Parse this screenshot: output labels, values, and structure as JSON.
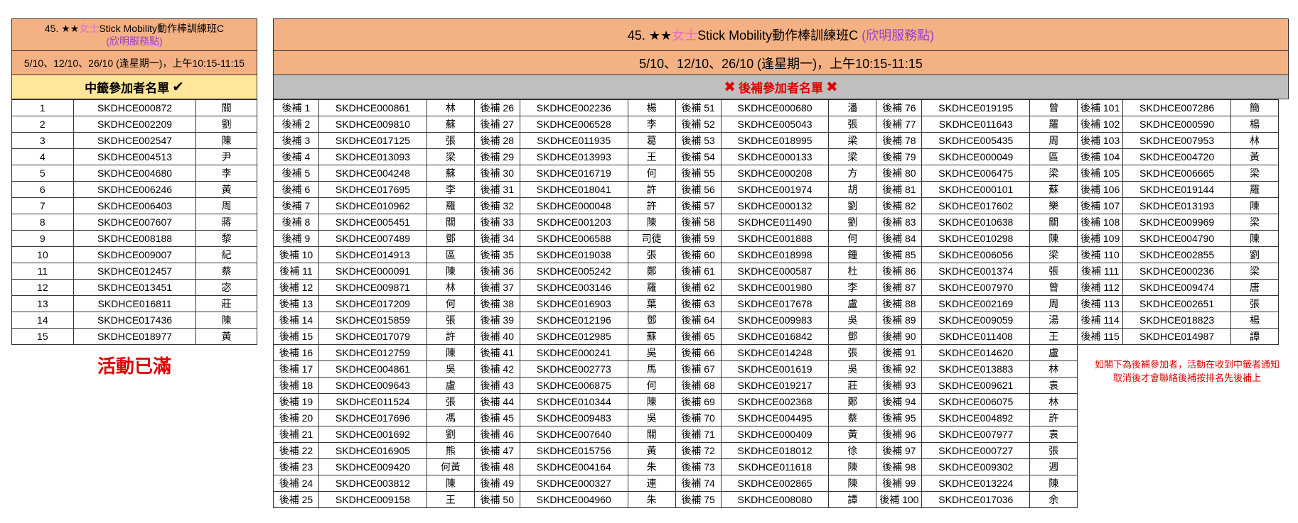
{
  "left": {
    "title_prefix": "45. ★★",
    "title_lady": "女士",
    "title_main": "Stick Mobility動作棒訓練班C",
    "center": "(欣明服務點)",
    "schedule": "5/10、12/10、26/10 (逢星期一)，上午10:15-11:15",
    "winners_title": "中籤參加者名單",
    "check": "✔",
    "rows": [
      [
        "1",
        "SKDHCE000872",
        "關"
      ],
      [
        "2",
        "SKDHCE002209",
        "劉"
      ],
      [
        "3",
        "SKDHCE002547",
        "陳"
      ],
      [
        "4",
        "SKDHCE004513",
        "尹"
      ],
      [
        "5",
        "SKDHCE004680",
        "李"
      ],
      [
        "6",
        "SKDHCE006246",
        "黃"
      ],
      [
        "7",
        "SKDHCE006403",
        "周"
      ],
      [
        "8",
        "SKDHCE007607",
        "蔣"
      ],
      [
        "9",
        "SKDHCE008188",
        "黎"
      ],
      [
        "10",
        "SKDHCE009007",
        "紀"
      ],
      [
        "11",
        "SKDHCE012457",
        "蔡"
      ],
      [
        "12",
        "SKDHCE013451",
        "宓"
      ],
      [
        "13",
        "SKDHCE016811",
        "莊"
      ],
      [
        "14",
        "SKDHCE017436",
        "陳"
      ],
      [
        "15",
        "SKDHCE018977",
        "黃"
      ]
    ],
    "full_label": "活動已滿"
  },
  "right": {
    "title_prefix": "45. ★★",
    "title_lady": "女士",
    "title_main": "Stick Mobility動作棒訓練班C ",
    "center": "(欣明服務點)",
    "schedule": "5/10、12/10、26/10 (逢星期一)，上午10:15-11:15",
    "waitlist_title": "後補參加者名單",
    "cross": "✖",
    "note_line1": "如閣下為後補參加者，活動在收到中籤者通知",
    "note_line2": "取消後才會聯絡後補按排名先後補上",
    "columns": [
      [
        [
          "後補 1",
          "SKDHCE000861",
          "林"
        ],
        [
          "後補 2",
          "SKDHCE009810",
          "蘇"
        ],
        [
          "後補 3",
          "SKDHCE017125",
          "張"
        ],
        [
          "後補 4",
          "SKDHCE013093",
          "梁"
        ],
        [
          "後補 5",
          "SKDHCE004248",
          "蘇"
        ],
        [
          "後補 6",
          "SKDHCE017695",
          "李"
        ],
        [
          "後補 7",
          "SKDHCE010962",
          "羅"
        ],
        [
          "後補 8",
          "SKDHCE005451",
          "關"
        ],
        [
          "後補 9",
          "SKDHCE007489",
          "鄧"
        ],
        [
          "後補 10",
          "SKDHCE014913",
          "區"
        ],
        [
          "後補 11",
          "SKDHCE000091",
          "陳"
        ],
        [
          "後補 12",
          "SKDHCE009871",
          "林"
        ],
        [
          "後補 13",
          "SKDHCE017209",
          "何"
        ],
        [
          "後補 14",
          "SKDHCE015859",
          "張"
        ],
        [
          "後補 15",
          "SKDHCE017079",
          "許"
        ],
        [
          "後補 16",
          "SKDHCE012759",
          "陳"
        ],
        [
          "後補 17",
          "SKDHCE004861",
          "吳"
        ],
        [
          "後補 18",
          "SKDHCE009643",
          "盧"
        ],
        [
          "後補 19",
          "SKDHCE011524",
          "張"
        ],
        [
          "後補 20",
          "SKDHCE017696",
          "馮"
        ],
        [
          "後補 21",
          "SKDHCE001692",
          "劉"
        ],
        [
          "後補 22",
          "SKDHCE016905",
          "熊"
        ],
        [
          "後補 23",
          "SKDHCE009420",
          "何黃"
        ],
        [
          "後補 24",
          "SKDHCE003812",
          "陳"
        ],
        [
          "後補 25",
          "SKDHCE009158",
          "王"
        ]
      ],
      [
        [
          "後補 26",
          "SKDHCE002236",
          "楊"
        ],
        [
          "後補 27",
          "SKDHCE006528",
          "李"
        ],
        [
          "後補 28",
          "SKDHCE011935",
          "葛"
        ],
        [
          "後補 29",
          "SKDHCE013993",
          "王"
        ],
        [
          "後補 30",
          "SKDHCE016719",
          "何"
        ],
        [
          "後補 31",
          "SKDHCE018041",
          "許"
        ],
        [
          "後補 32",
          "SKDHCE000048",
          "許"
        ],
        [
          "後補 33",
          "SKDHCE001203",
          "陳"
        ],
        [
          "後補 34",
          "SKDHCE006588",
          "司徒"
        ],
        [
          "後補 35",
          "SKDHCE019038",
          "張"
        ],
        [
          "後補 36",
          "SKDHCE005242",
          "鄭"
        ],
        [
          "後補 37",
          "SKDHCE003146",
          "羅"
        ],
        [
          "後補 38",
          "SKDHCE016903",
          "葉"
        ],
        [
          "後補 39",
          "SKDHCE012196",
          "鄧"
        ],
        [
          "後補 40",
          "SKDHCE012985",
          "蘇"
        ],
        [
          "後補 41",
          "SKDHCE000241",
          "吳"
        ],
        [
          "後補 42",
          "SKDHCE002773",
          "馬"
        ],
        [
          "後補 43",
          "SKDHCE006875",
          "何"
        ],
        [
          "後補 44",
          "SKDHCE010344",
          "陳"
        ],
        [
          "後補 45",
          "SKDHCE009483",
          "吳"
        ],
        [
          "後補 46",
          "SKDHCE007640",
          "關"
        ],
        [
          "後補 47",
          "SKDHCE015756",
          "黃"
        ],
        [
          "後補 48",
          "SKDHCE004164",
          "朱"
        ],
        [
          "後補 49",
          "SKDHCE000327",
          "連"
        ],
        [
          "後補 50",
          "SKDHCE004960",
          "朱"
        ]
      ],
      [
        [
          "後補 51",
          "SKDHCE000680",
          "潘"
        ],
        [
          "後補 52",
          "SKDHCE005043",
          "張"
        ],
        [
          "後補 53",
          "SKDHCE018995",
          "梁"
        ],
        [
          "後補 54",
          "SKDHCE000133",
          "梁"
        ],
        [
          "後補 55",
          "SKDHCE000208",
          "方"
        ],
        [
          "後補 56",
          "SKDHCE001974",
          "胡"
        ],
        [
          "後補 57",
          "SKDHCE000132",
          "劉"
        ],
        [
          "後補 58",
          "SKDHCE011490",
          "劉"
        ],
        [
          "後補 59",
          "SKDHCE001888",
          "何"
        ],
        [
          "後補 60",
          "SKDHCE018998",
          "鍾"
        ],
        [
          "後補 61",
          "SKDHCE000587",
          "杜"
        ],
        [
          "後補 62",
          "SKDHCE001980",
          "李"
        ],
        [
          "後補 63",
          "SKDHCE017678",
          "盧"
        ],
        [
          "後補 64",
          "SKDHCE009983",
          "吳"
        ],
        [
          "後補 65",
          "SKDHCE016842",
          "鄧"
        ],
        [
          "後補 66",
          "SKDHCE014248",
          "張"
        ],
        [
          "後補 67",
          "SKDHCE001619",
          "吳"
        ],
        [
          "後補 68",
          "SKDHCE019217",
          "莊"
        ],
        [
          "後補 69",
          "SKDHCE002368",
          "鄭"
        ],
        [
          "後補 70",
          "SKDHCE004495",
          "蔡"
        ],
        [
          "後補 71",
          "SKDHCE000409",
          "黃"
        ],
        [
          "後補 72",
          "SKDHCE018012",
          "徐"
        ],
        [
          "後補 73",
          "SKDHCE011618",
          "陳"
        ],
        [
          "後補 74",
          "SKDHCE002865",
          "陳"
        ],
        [
          "後補 75",
          "SKDHCE008080",
          "譚"
        ]
      ],
      [
        [
          "後補 76",
          "SKDHCE019195",
          "曾"
        ],
        [
          "後補 77",
          "SKDHCE011643",
          "羅"
        ],
        [
          "後補 78",
          "SKDHCE005435",
          "周"
        ],
        [
          "後補 79",
          "SKDHCE000049",
          "區"
        ],
        [
          "後補 80",
          "SKDHCE006475",
          "梁"
        ],
        [
          "後補 81",
          "SKDHCE000101",
          "蘇"
        ],
        [
          "後補 82",
          "SKDHCE017602",
          "樂"
        ],
        [
          "後補 83",
          "SKDHCE010638",
          "關"
        ],
        [
          "後補 84",
          "SKDHCE010298",
          "陳"
        ],
        [
          "後補 85",
          "SKDHCE006056",
          "梁"
        ],
        [
          "後補 86",
          "SKDHCE001374",
          "張"
        ],
        [
          "後補 87",
          "SKDHCE007970",
          "曾"
        ],
        [
          "後補 88",
          "SKDHCE002169",
          "周"
        ],
        [
          "後補 89",
          "SKDHCE009059",
          "湯"
        ],
        [
          "後補 90",
          "SKDHCE011408",
          "王"
        ],
        [
          "後補 91",
          "SKDHCE014620",
          "盧"
        ],
        [
          "後補 92",
          "SKDHCE013883",
          "林"
        ],
        [
          "後補 93",
          "SKDHCE009621",
          "袁"
        ],
        [
          "後補 94",
          "SKDHCE006075",
          "林"
        ],
        [
          "後補 95",
          "SKDHCE004892",
          "許"
        ],
        [
          "後補 96",
          "SKDHCE007977",
          "袁"
        ],
        [
          "後補 97",
          "SKDHCE000727",
          "張"
        ],
        [
          "後補 98",
          "SKDHCE009302",
          "週"
        ],
        [
          "後補 99",
          "SKDHCE013224",
          "陳"
        ],
        [
          "後補 100",
          "SKDHCE017036",
          "余"
        ]
      ],
      [
        [
          "後補 101",
          "SKDHCE007286",
          "簡"
        ],
        [
          "後補 102",
          "SKDHCE000590",
          "楊"
        ],
        [
          "後補 103",
          "SKDHCE007953",
          "林"
        ],
        [
          "後補 104",
          "SKDHCE004720",
          "黃"
        ],
        [
          "後補 105",
          "SKDHCE006665",
          "梁"
        ],
        [
          "後補 106",
          "SKDHCE019144",
          "羅"
        ],
        [
          "後補 107",
          "SKDHCE013193",
          "陳"
        ],
        [
          "後補 108",
          "SKDHCE009969",
          "梁"
        ],
        [
          "後補 109",
          "SKDHCE004790",
          "陳"
        ],
        [
          "後補 110",
          "SKDHCE002855",
          "劉"
        ],
        [
          "後補 111",
          "SKDHCE000236",
          "梁"
        ],
        [
          "後補 112",
          "SKDHCE009474",
          "唐"
        ],
        [
          "後補 113",
          "SKDHCE002651",
          "張"
        ],
        [
          "後補 114",
          "SKDHCE018823",
          "楊"
        ],
        [
          "後補 115",
          "SKDHCE014987",
          "譚"
        ]
      ]
    ]
  }
}
